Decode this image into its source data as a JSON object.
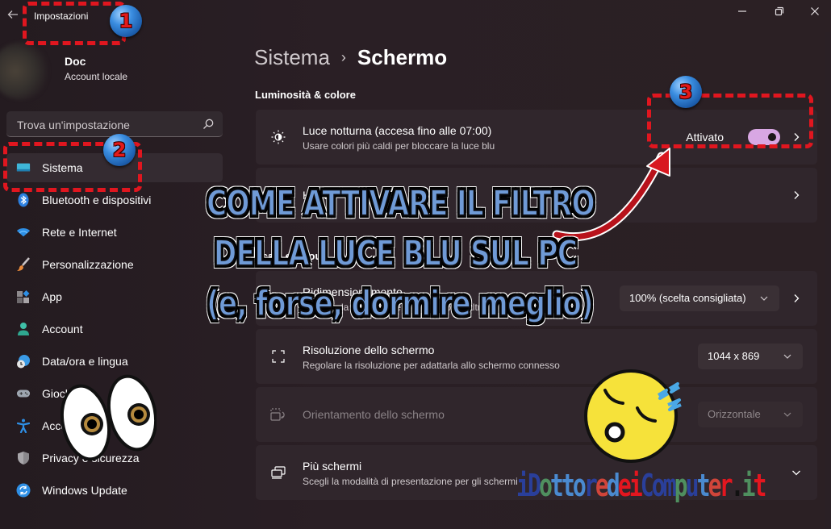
{
  "window": {
    "title": "Impostazioni",
    "controls": {
      "minimize": "minimize-icon",
      "maximize": "restore-icon",
      "close": "close-icon"
    }
  },
  "account": {
    "name": "Doc",
    "type": "Account locale"
  },
  "search": {
    "placeholder": "Trova un'impostazione",
    "value": ""
  },
  "sidebar": {
    "items": [
      {
        "label": "Sistema",
        "icon": "monitor-icon",
        "active": true
      },
      {
        "label": "Bluetooth e dispositivi",
        "icon": "bluetooth-icon"
      },
      {
        "label": "Rete e Internet",
        "icon": "wifi-icon"
      },
      {
        "label": "Personalizzazione",
        "icon": "brush-icon"
      },
      {
        "label": "App",
        "icon": "apps-icon"
      },
      {
        "label": "Account",
        "icon": "person-icon"
      },
      {
        "label": "Data/ora e lingua",
        "icon": "globe-clock-icon"
      },
      {
        "label": "Giochi",
        "icon": "gamepad-icon"
      },
      {
        "label": "Accessibilità",
        "icon": "accessibility-icon"
      },
      {
        "label": "Privacy e sicurezza",
        "icon": "shield-icon"
      },
      {
        "label": "Windows Update",
        "icon": "update-icon"
      }
    ]
  },
  "breadcrumb": {
    "parent": "Sistema",
    "separator": "›",
    "current": "Schermo"
  },
  "sections": {
    "brightness": {
      "title": "Luminosità & colore",
      "night_light": {
        "title": "Luce notturna (accesa fino alle 07:00)",
        "subtitle": "Usare colori più caldi per bloccare la luce blu",
        "toggle_label": "Attivato",
        "toggle_on": true,
        "accent": "#d8a7e3"
      },
      "hdr": {
        "icon_label": "HD",
        "title": "HDR"
      }
    },
    "scale_layout": {
      "title": "Scala e layout",
      "scale": {
        "title": "Ridimensionamento",
        "subtitle": "Modifica la dimensione di testo, app e altri elementi",
        "value": "100% (scelta consigliata)"
      },
      "resolution": {
        "title": "Risoluzione dello schermo",
        "subtitle": "Regolare la risoluzione per adattarla allo schermo connesso",
        "value": "1044 x 869"
      },
      "orientation": {
        "title": "Orientamento dello schermo",
        "value": "Orizzontale",
        "disabled": true
      },
      "multi": {
        "title": "Più schermi",
        "subtitle": "Scegli la modalità di presentazione per gli schermi"
      }
    }
  },
  "overlay": {
    "headline": [
      "COME ATTIVARE IL FILTRO",
      "DELLA LUCE BLU SUL PC",
      "(e, forse, dormire meglio)"
    ],
    "steps": [
      "1",
      "2",
      "3"
    ],
    "annotation_color": "#e0161f",
    "headline_color": "#6f9ad6",
    "logo_parts": [
      {
        "text": "i",
        "color": "#2a3f9a"
      },
      {
        "text": "D",
        "color": "#2a3f9a"
      },
      {
        "text": "o",
        "color": "#4f8f5f"
      },
      {
        "text": "tto",
        "color": "#4a8ad0"
      },
      {
        "text": "r",
        "color": "#2a3f9a"
      },
      {
        "text": "e",
        "color": "#d0453a"
      },
      {
        "text": "d",
        "color": "#4a8ad0"
      },
      {
        "text": "ei",
        "color": "#e3161f"
      },
      {
        "text": "C",
        "color": "#2a3f9a"
      },
      {
        "text": "om",
        "color": "#2a3f9a"
      },
      {
        "text": "p",
        "color": "#4f8f5f"
      },
      {
        "text": "u",
        "color": "#2a3f9a"
      },
      {
        "text": "t",
        "color": "#4a8ad0"
      },
      {
        "text": "e",
        "color": "#d0453a"
      },
      {
        "text": "r",
        "color": "#e3161f"
      },
      {
        "text": ".",
        "color": "#111111"
      },
      {
        "text": "i",
        "color": "#4f8f5f"
      },
      {
        "text": "t",
        "color": "#e3161f"
      }
    ]
  }
}
